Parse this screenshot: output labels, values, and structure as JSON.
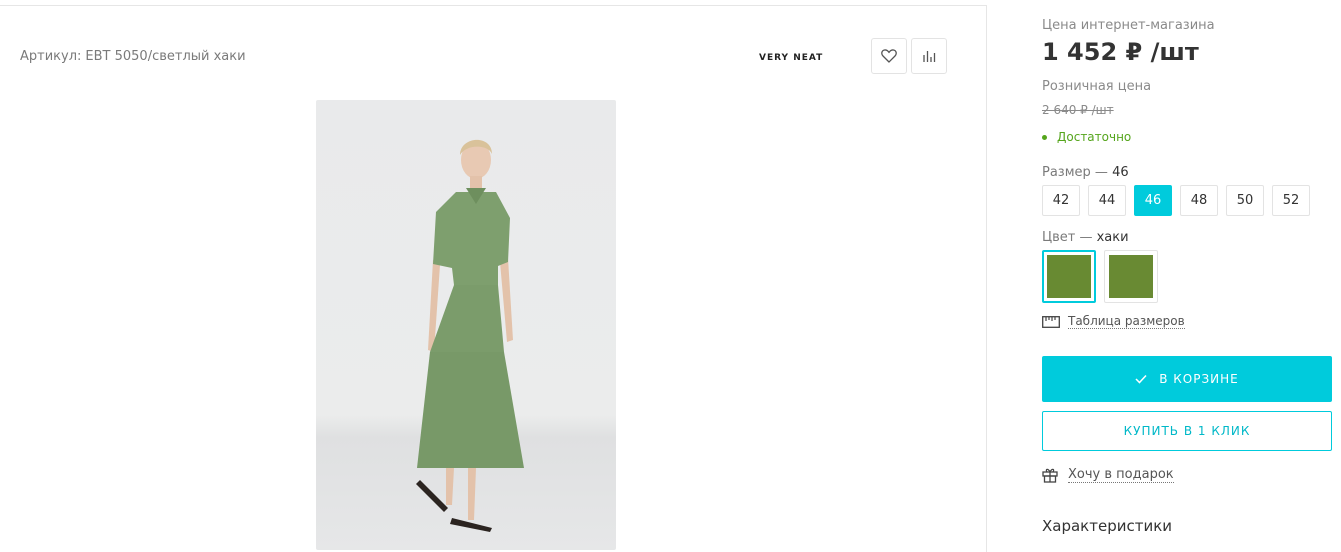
{
  "product": {
    "article_label": "Артикул:",
    "article_value": "EBT 5050/светлый хаки",
    "brand": "VERY NEAT",
    "icons": {
      "favorite": "heart-icon",
      "compare": "bar-chart-icon"
    }
  },
  "pricing": {
    "online_label": "Цена интернет-магазина",
    "online_price": "1 452 ₽ /шт",
    "retail_label": "Розничная цена",
    "retail_price": "2 640 ₽ /шт",
    "stock": "Достаточно",
    "stock_color": "#55a51c"
  },
  "size": {
    "label": "Размер  —",
    "selected": "46",
    "options": [
      "42",
      "44",
      "46",
      "48",
      "50",
      "52"
    ]
  },
  "color": {
    "label": "Цвет  —",
    "selected": "хаки",
    "swatches": [
      "#688a32",
      "#698a33"
    ]
  },
  "size_table": "Таблица размеров",
  "actions": {
    "cart": "В КОРЗИНЕ",
    "one_click": "КУПИТЬ В 1 КЛИК",
    "gift": "Хочу в подарок"
  },
  "specs_title": "Характеристики",
  "colors": {
    "accent": "#00cbdc",
    "stock": "#55a51c"
  }
}
